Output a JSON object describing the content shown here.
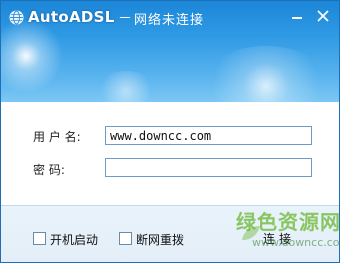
{
  "titlebar": {
    "app_name": "AutoADSL",
    "separator": "－",
    "status": "网络未连接"
  },
  "form": {
    "username_label": "用 户 名:",
    "username_value": "www.downcc.com",
    "password_label": "密    码:",
    "password_value": ""
  },
  "footer": {
    "autostart_label": "开机启动",
    "autostart_checked": false,
    "redial_label": "断网重拨",
    "redial_checked": false,
    "connect_label": "连接"
  },
  "watermark": {
    "text": "绿色资源网",
    "url": "www.downcc.com"
  },
  "colors": {
    "header_top": "#1c86d8",
    "header_bottom": "#7cc7f4",
    "footer_bg": "#e9f3fb",
    "input_border": "#6d9bc7",
    "watermark_green": "#78be46"
  },
  "icons": [
    "app-globe-icon",
    "minimize-icon",
    "close-icon"
  ]
}
